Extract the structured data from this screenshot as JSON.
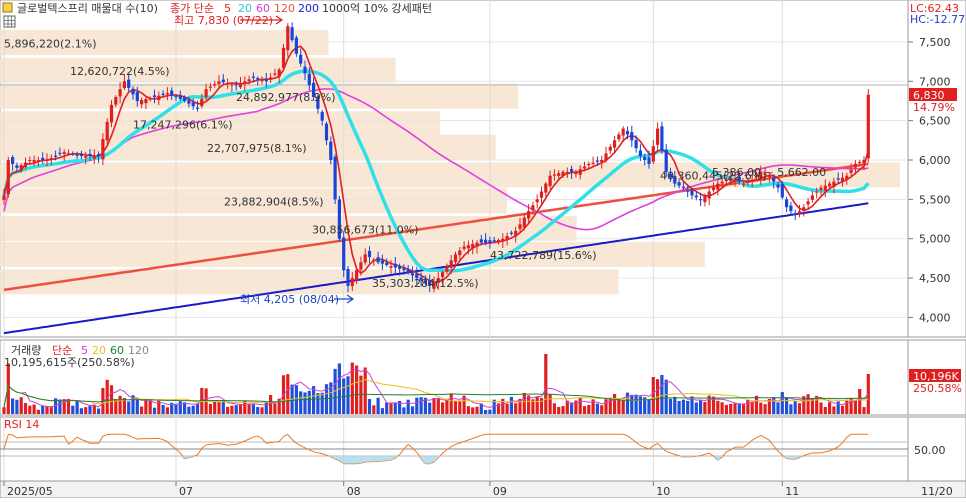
{
  "header": {
    "title": "글로벌텍스프리 매물대 수(10)",
    "ma_label": "종가 단순",
    "ma_periods": [
      "5",
      "20",
      "60",
      "120",
      "200"
    ],
    "ma_colors": [
      "#e02020",
      "#30e0e8",
      "#e040e0",
      "#ee5040",
      "#1a1ac8"
    ],
    "indicator": "1000억 10% 강세패턴",
    "lc": "LC:62.43",
    "hc": "HC:-12.77"
  },
  "annotations": {
    "high": "최고 7,830 (07/22)",
    "low": "최저 4,205 (08/04)",
    "price_tag": "6,830",
    "pct_tag": "14.79%"
  },
  "volume_header": {
    "label": "거래량",
    "ma_label": "단순",
    "ma_periods": [
      "5",
      "20",
      "60",
      "120"
    ],
    "value": "10,195,615주(250.58%)",
    "tag": "10,196K",
    "pct_tag": "250.58%"
  },
  "rsi_header": {
    "label": "RSI 14",
    "tick": "50.00"
  },
  "chart_data": {
    "type": "candlestick",
    "price_ticks": [
      4000,
      4500,
      5000,
      5500,
      6000,
      6500,
      7000,
      7500
    ],
    "price_tick_labels": [
      "4,000",
      "4,500",
      "5,000",
      "5,500",
      "6,000",
      "6,500",
      "7,000",
      "7,500"
    ],
    "month_labels": [
      {
        "label": "2025/05",
        "index": 0
      },
      {
        "label": "07",
        "index": 40
      },
      {
        "label": "08",
        "index": 79
      },
      {
        "label": "09",
        "index": 113
      },
      {
        "label": "10",
        "index": 151
      },
      {
        "label": "11",
        "index": 181
      },
      {
        "label": "11/20",
        "index": 210
      }
    ],
    "anchors": [
      [
        0,
        5550
      ],
      [
        1,
        6000
      ],
      [
        3,
        5900
      ],
      [
        6,
        6000
      ],
      [
        10,
        6000
      ],
      [
        14,
        6100
      ],
      [
        18,
        6050
      ],
      [
        22,
        6050
      ],
      [
        25,
        6700
      ],
      [
        28,
        7000
      ],
      [
        31,
        6750
      ],
      [
        35,
        6800
      ],
      [
        38,
        6850
      ],
      [
        42,
        6750
      ],
      [
        45,
        6650
      ],
      [
        47,
        6900
      ],
      [
        50,
        7000
      ],
      [
        54,
        6950
      ],
      [
        58,
        7050
      ],
      [
        61,
        7000
      ],
      [
        64,
        7150
      ],
      [
        66,
        7700
      ],
      [
        68,
        7350
      ],
      [
        70,
        7100
      ],
      [
        72,
        6800
      ],
      [
        74,
        6500
      ],
      [
        76,
        6000
      ],
      [
        77,
        5500
      ],
      [
        78,
        5000
      ],
      [
        79,
        4600
      ],
      [
        80,
        4400
      ],
      [
        82,
        4600
      ],
      [
        84,
        4800
      ],
      [
        87,
        4700
      ],
      [
        90,
        4650
      ],
      [
        93,
        4600
      ],
      [
        96,
        4500
      ],
      [
        99,
        4400
      ],
      [
        101,
        4500
      ],
      [
        103,
        4650
      ],
      [
        105,
        4800
      ],
      [
        107,
        4900
      ],
      [
        110,
        4950
      ],
      [
        113,
        4950
      ],
      [
        116,
        5000
      ],
      [
        119,
        5100
      ],
      [
        122,
        5350
      ],
      [
        124,
        5500
      ],
      [
        127,
        5800
      ],
      [
        130,
        5850
      ],
      [
        133,
        5850
      ],
      [
        136,
        5950
      ],
      [
        139,
        6000
      ],
      [
        142,
        6250
      ],
      [
        144,
        6400
      ],
      [
        146,
        6250
      ],
      [
        148,
        6050
      ],
      [
        150,
        5950
      ],
      [
        152,
        6400
      ],
      [
        154,
        5850
      ],
      [
        156,
        5700
      ],
      [
        158,
        5650
      ],
      [
        160,
        5550
      ],
      [
        162,
        5500
      ],
      [
        164,
        5600
      ],
      [
        166,
        5700
      ],
      [
        168,
        5750
      ],
      [
        170,
        5750
      ],
      [
        172,
        5700
      ],
      [
        174,
        5750
      ],
      [
        176,
        5850
      ],
      [
        178,
        5800
      ],
      [
        180,
        5650
      ],
      [
        182,
        5400
      ],
      [
        184,
        5300
      ],
      [
        186,
        5400
      ],
      [
        188,
        5550
      ],
      [
        190,
        5650
      ],
      [
        192,
        5700
      ],
      [
        194,
        5750
      ],
      [
        196,
        5800
      ],
      [
        198,
        5950
      ],
      [
        200,
        6000
      ],
      [
        201,
        6830
      ]
    ],
    "volume_profile": [
      {
        "label": "5,896,220(2.1%)",
        "price": 7480
      },
      {
        "label": "12,620,722(4.5%)",
        "price": 7130
      },
      {
        "label": "24,892,977(8.9%)",
        "price": 6800
      },
      {
        "label": "17,247,296(6.1%)",
        "price": 6450
      },
      {
        "label": "22,707,975(8.1%)",
        "price": 6150
      },
      {
        "label": "40,360,445(22.6%)",
        "price": 5800
      },
      {
        "label": "23,882,904(8.5%)",
        "price": 5470
      },
      {
        "label": "30,856,673(11.0%)",
        "price": 5120
      },
      {
        "label": "43,722,789(15.6%)",
        "price": 4790
      },
      {
        "label": "35,303,284(12.5%)",
        "price": 4440
      }
    ],
    "profile_range": "5,386.00 ~ 5,662.00"
  }
}
